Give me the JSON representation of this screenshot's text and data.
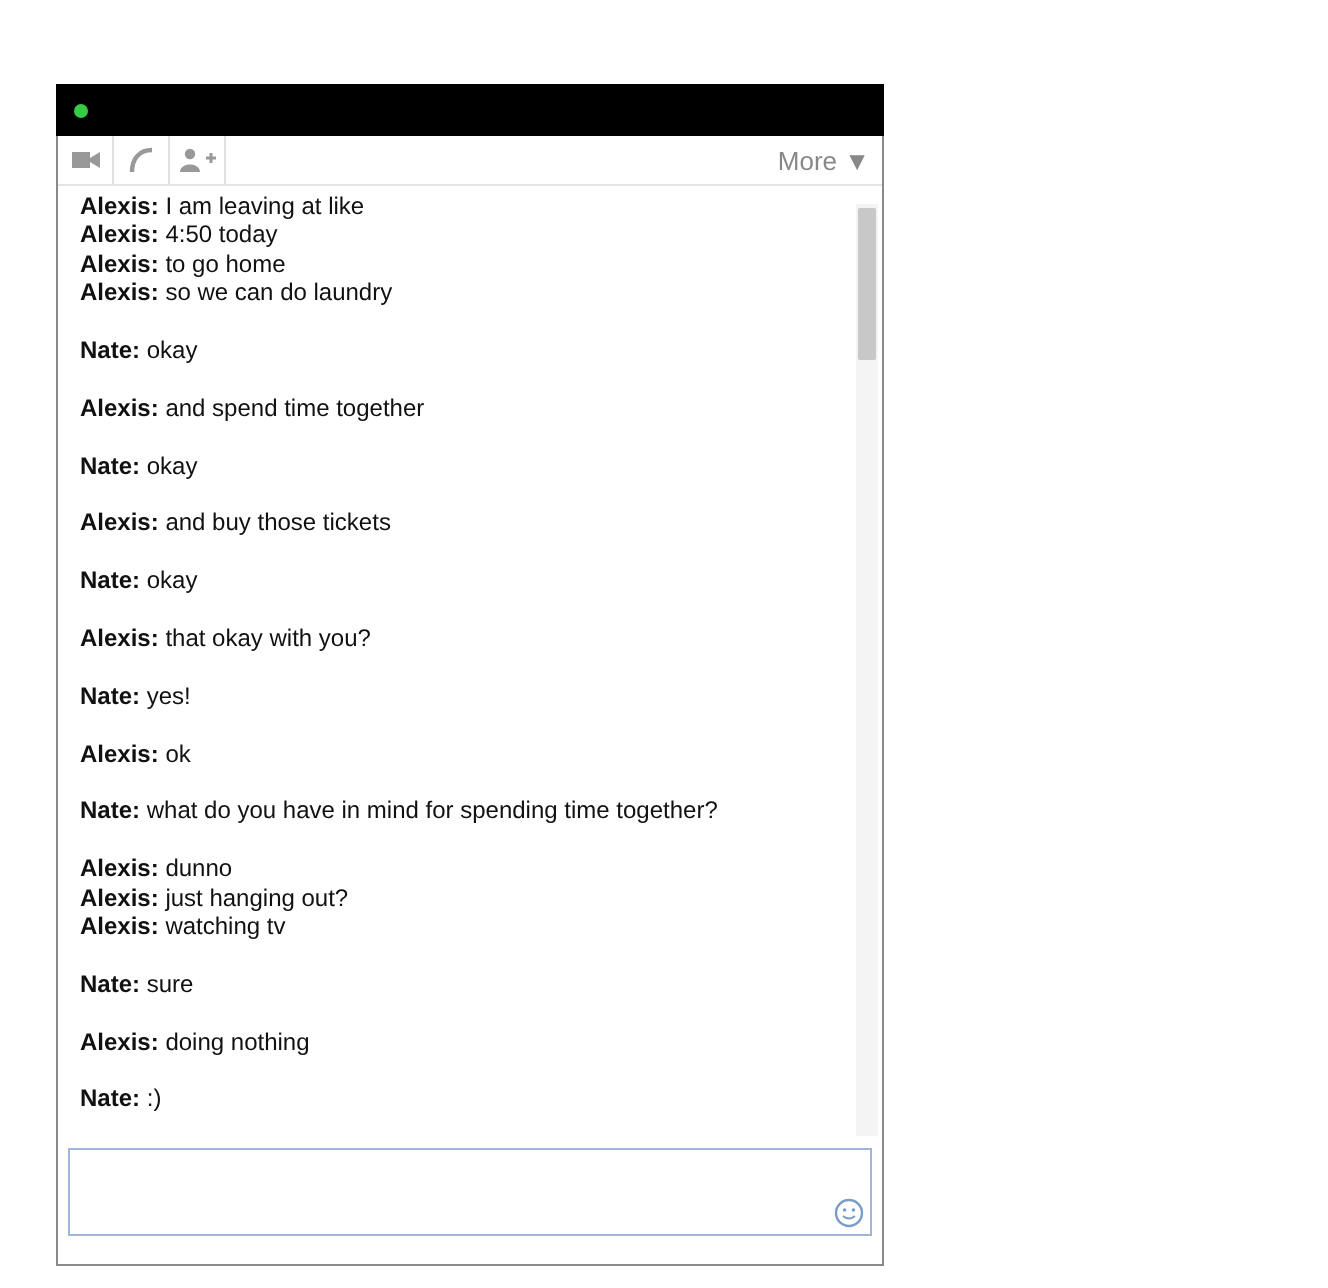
{
  "status_dot": {
    "online": true
  },
  "toolbar": {
    "more_label": "More ▼"
  },
  "messages": [
    {
      "lines": [
        {
          "sender": "Alexis:",
          "text": "I am leaving at like"
        },
        {
          "sender": "Alexis:",
          "text": "4:50 today"
        },
        {
          "sender": "Alexis:",
          "text": "to go home"
        },
        {
          "sender": "Alexis:",
          "text": "so we can do laundry"
        }
      ]
    },
    {
      "lines": [
        {
          "sender": "Nate:",
          "text": "okay"
        }
      ]
    },
    {
      "lines": [
        {
          "sender": "Alexis:",
          "text": "and spend time together"
        }
      ]
    },
    {
      "lines": [
        {
          "sender": "Nate:",
          "text": "okay"
        }
      ]
    },
    {
      "lines": [
        {
          "sender": "Alexis:",
          "text": "and buy those tickets"
        }
      ]
    },
    {
      "lines": [
        {
          "sender": "Nate:",
          "text": "okay"
        }
      ]
    },
    {
      "lines": [
        {
          "sender": "Alexis:",
          "text": "that okay with you?"
        }
      ]
    },
    {
      "lines": [
        {
          "sender": "Nate:",
          "text": "yes!"
        }
      ]
    },
    {
      "lines": [
        {
          "sender": "Alexis:",
          "text": "ok"
        }
      ]
    },
    {
      "lines": [
        {
          "sender": "Nate:",
          "text": "what do you have in mind for spending time together?"
        }
      ]
    },
    {
      "lines": [
        {
          "sender": "Alexis:",
          "text": "dunno"
        },
        {
          "sender": "Alexis:",
          "text": "just hanging out?"
        },
        {
          "sender": "Alexis:",
          "text": "watching tv"
        }
      ]
    },
    {
      "lines": [
        {
          "sender": "Nate:",
          "text": "sure"
        }
      ]
    },
    {
      "lines": [
        {
          "sender": "Alexis:",
          "text": "doing nothing"
        }
      ]
    },
    {
      "lines": [
        {
          "sender": "Nate:",
          "text": ":)"
        }
      ]
    }
  ]
}
